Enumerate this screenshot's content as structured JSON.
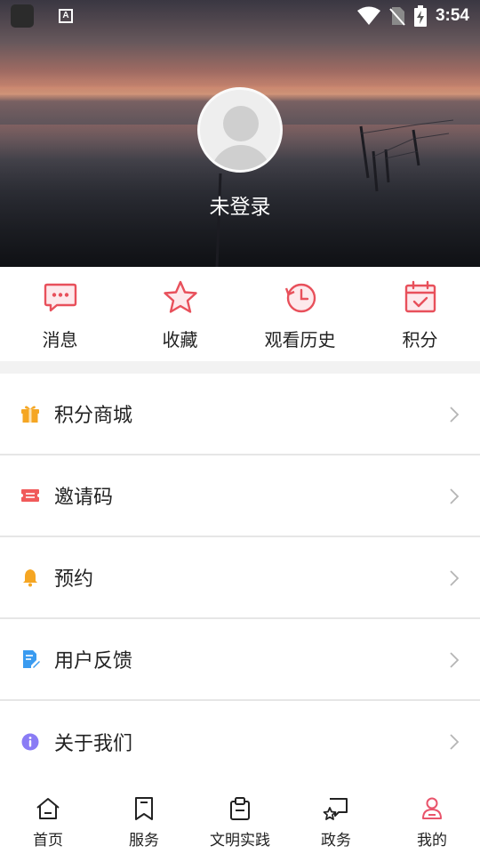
{
  "statusbar": {
    "time": "3:54",
    "a_glyph": "A"
  },
  "profile": {
    "login_status": "未登录"
  },
  "quick_actions": [
    {
      "label": "消息",
      "icon": "message-icon"
    },
    {
      "label": "收藏",
      "icon": "star-icon"
    },
    {
      "label": "观看历史",
      "icon": "history-icon"
    },
    {
      "label": "积分",
      "icon": "calendar-check-icon"
    }
  ],
  "menu": [
    {
      "label": "积分商城",
      "icon": "gift-icon",
      "color": "#f5a623"
    },
    {
      "label": "邀请码",
      "icon": "ticket-icon",
      "color": "#f05a5a"
    },
    {
      "label": "预约",
      "icon": "bell-icon",
      "color": "#f5a623"
    },
    {
      "label": "用户反馈",
      "icon": "feedback-icon",
      "color": "#3a9bf0"
    },
    {
      "label": "关于我们",
      "icon": "info-icon",
      "color": "#8a7cf5"
    }
  ],
  "tabs": [
    {
      "label": "首页",
      "icon": "home-icon",
      "active": false
    },
    {
      "label": "服务",
      "icon": "bookmark-icon",
      "active": false
    },
    {
      "label": "文明实践",
      "icon": "clipboard-icon",
      "active": false
    },
    {
      "label": "政务",
      "icon": "chat-star-icon",
      "active": false
    },
    {
      "label": "我的",
      "icon": "person-icon",
      "active": true
    }
  ],
  "colors": {
    "accent": "#e9546b",
    "icon_red": "#e8505b",
    "chevron": "#b5b5b5"
  }
}
